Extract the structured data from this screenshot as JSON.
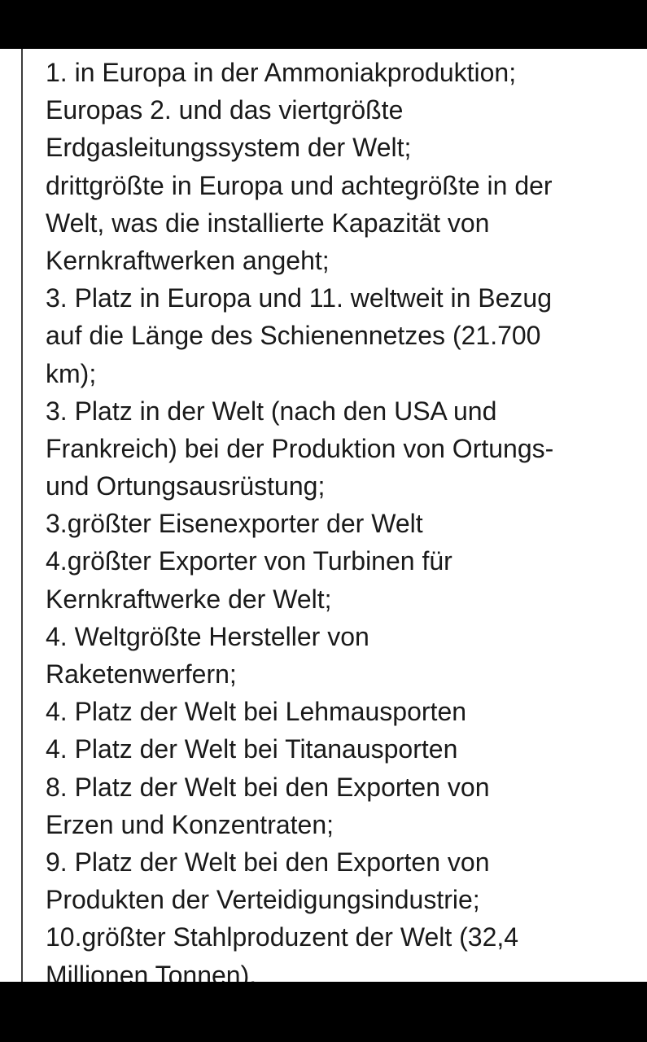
{
  "document": {
    "lines": [
      "1. in Europa in der Ammoniakproduktion;",
      "Europas 2. und das viertgrößte",
      "Erdgasleitungssystem der Welt;",
      "drittgrößte in Europa und achtegrößte in der",
      "Welt, was die installierte Kapazität von",
      "Kernkraftwerken angeht;",
      "3. Platz in Europa und 11. weltweit in Bezug",
      "auf die Länge des Schienennetzes (21.700",
      "km);",
      "3. Platz in der Welt (nach den USA und",
      "Frankreich) bei der Produktion von Ortungs-",
      "und Ortungsausrüstung;",
      "3.größter Eisenexporter der Welt",
      "4.größter Exporter von Turbinen für",
      "Kernkraftwerke der Welt;",
      "4. Weltgrößte Hersteller von",
      "Raketenwerfern;",
      "4. Platz der Welt bei Lehmausporten",
      "4. Platz der Welt bei Titanausporten",
      "8. Platz der Welt bei den Exporten von",
      "Erzen und Konzentraten;",
      "9. Platz der Welt bei den Exporten von",
      "Produkten der Verteidigungsindustrie;",
      "10.größter Stahlproduzent der Welt (32,4",
      "Millionen Tonnen)."
    ]
  },
  "colors": {
    "background": "#000000",
    "page": "#ffffff",
    "text": "#1a1a1a",
    "margin_line": "#3c3c3c"
  }
}
